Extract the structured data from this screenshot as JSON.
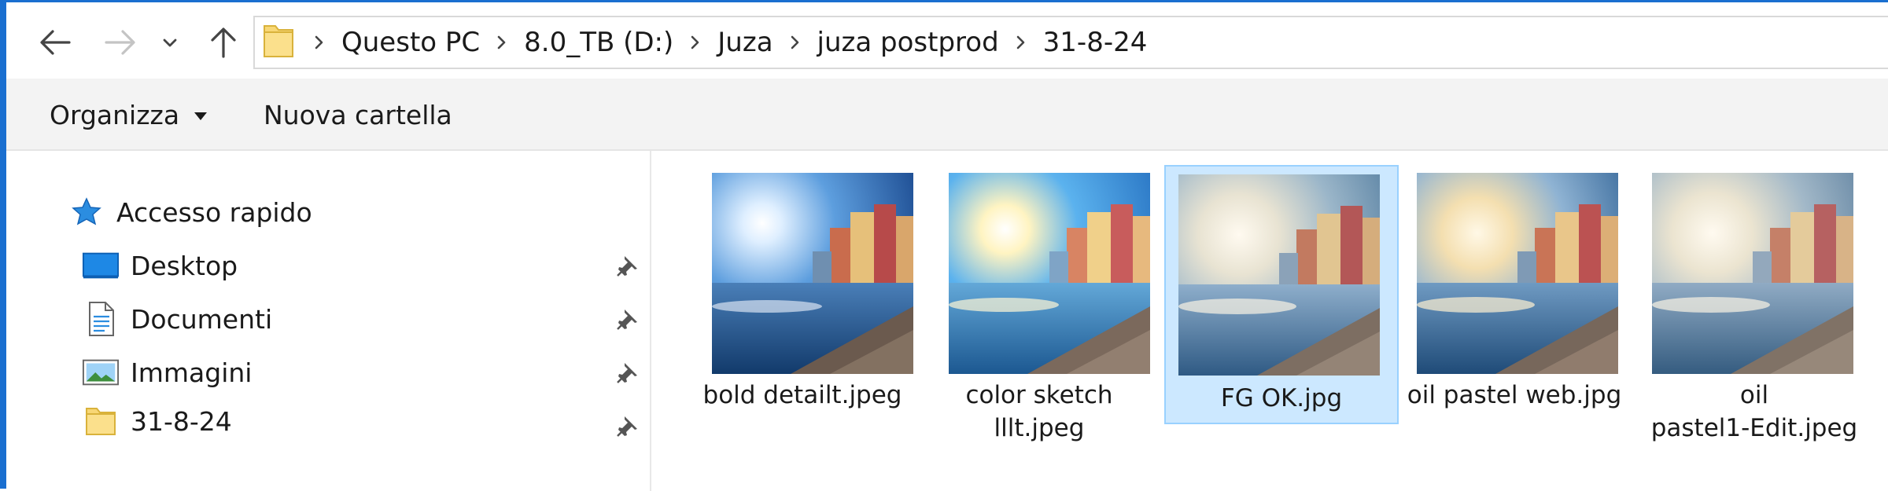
{
  "address_bar": {
    "breadcrumbs": [
      "Questo PC",
      "8.0_TB (D:)",
      "Juza",
      "juza postprod",
      "31-8-24"
    ],
    "icons": [
      "back-arrow-icon",
      "forward-arrow-icon",
      "chevron-down-icon",
      "up-arrow-icon",
      "folder-icon",
      "breadcrumb-separator-icon"
    ]
  },
  "ribbon": {
    "organize_label": "Organizza",
    "new_folder_label": "Nuova cartella"
  },
  "nav_pane": {
    "quick_access_label": "Accesso rapido",
    "items": [
      {
        "label": "Desktop",
        "icon": "desktop-icon",
        "pinned": true
      },
      {
        "label": "Documenti",
        "icon": "documents-icon",
        "pinned": true
      },
      {
        "label": "Immagini",
        "icon": "pictures-icon",
        "pinned": true
      },
      {
        "label": "31-8-24",
        "icon": "folder-icon",
        "pinned": true
      }
    ]
  },
  "files": [
    {
      "name": "bold detailt.jpeg",
      "selected": false
    },
    {
      "name": "color sketch\nlllt.jpeg",
      "selected": false
    },
    {
      "name": "FG OK.jpg",
      "selected": true
    },
    {
      "name": "oil pastel web.jpg",
      "selected": false
    },
    {
      "name": "oil\npastel1-Edit.jpeg",
      "selected": false
    }
  ],
  "colors": {
    "accent_border": "#1a6fd0",
    "selection_fill": "#cce8ff",
    "selection_border": "#99d1ff",
    "folder_yellow": "#f8d775",
    "ribbon_bg": "#f3f3f3"
  }
}
